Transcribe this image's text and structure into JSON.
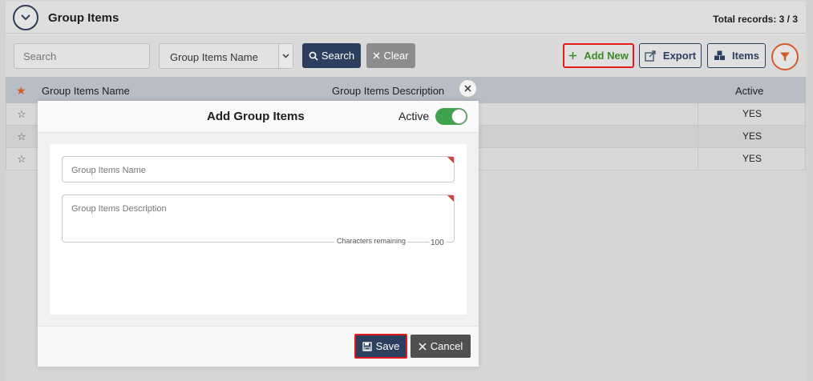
{
  "header": {
    "title": "Group Items",
    "records": "Total records: 3 / 3"
  },
  "toolbar": {
    "search_placeholder": "Search",
    "column_select": "Group Items Name",
    "search_label": "Search",
    "clear_label": "Clear",
    "add_new_label": "Add New",
    "export_label": "Export",
    "items_label": "Items"
  },
  "grid": {
    "columns": [
      "Group Items Name",
      "Group Items Description",
      "Active"
    ],
    "rows": [
      {
        "active": "YES"
      },
      {
        "active": "YES"
      },
      {
        "active": "YES"
      }
    ]
  },
  "modal": {
    "title": "Add Group Items",
    "active_label": "Active",
    "active_on": true,
    "name_placeholder": "Group Items Name",
    "description_placeholder": "Group Items Description",
    "chars_label": "Characters remaining",
    "chars_count": "100",
    "save_label": "Save",
    "cancel_label": "Cancel"
  },
  "colors": {
    "primary": "#2d3f5e",
    "highlight": "#e11b1b",
    "add_green": "#3a8b2a",
    "toggle_on": "#3fa34d",
    "accent_orange": "#d35b2c"
  }
}
